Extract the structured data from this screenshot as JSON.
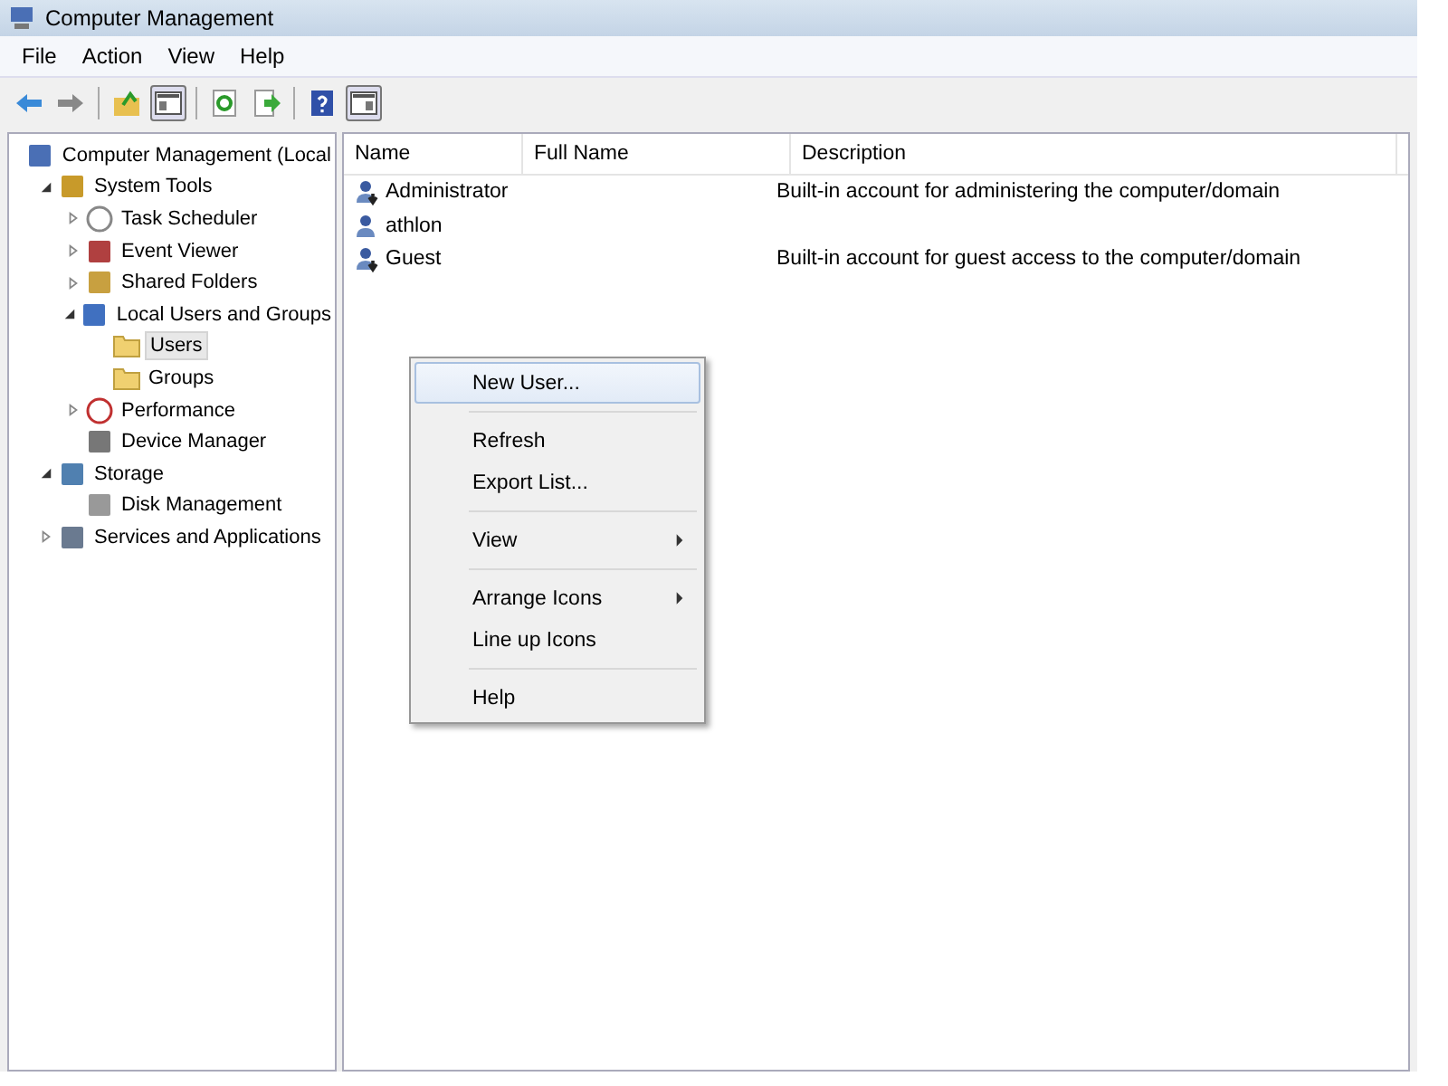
{
  "window": {
    "title": "Computer Management"
  },
  "menu_bar": [
    "File",
    "Action",
    "View",
    "Help"
  ],
  "toolbar": [
    {
      "kind": "back"
    },
    {
      "kind": "forward"
    },
    {
      "kind": "sep"
    },
    {
      "kind": "up"
    },
    {
      "kind": "pane",
      "selected": true
    },
    {
      "kind": "sep"
    },
    {
      "kind": "refresh"
    },
    {
      "kind": "export"
    },
    {
      "kind": "sep"
    },
    {
      "kind": "help"
    },
    {
      "kind": "pane2",
      "selected": true
    }
  ],
  "tree": [
    {
      "label": "Computer Management (Local",
      "kind": "computer",
      "selected": false,
      "children": [
        {
          "label": "System Tools",
          "kind": "tools",
          "selected": false,
          "expanded": true,
          "children": [
            {
              "label": "Task Scheduler",
              "kind": "clock",
              "selected": false,
              "expanded": false
            },
            {
              "label": "Event Viewer",
              "kind": "log",
              "selected": false,
              "expanded": false
            },
            {
              "label": "Shared Folders",
              "kind": "share",
              "selected": false,
              "expanded": false
            },
            {
              "label": "Local Users and Groups",
              "kind": "users",
              "selected": false,
              "expanded": true,
              "children": [
                {
                  "label": "Users",
                  "kind": "folder",
                  "selected": true
                },
                {
                  "label": "Groups",
                  "kind": "folder",
                  "selected": false
                }
              ]
            },
            {
              "label": "Performance",
              "kind": "performance",
              "selected": false,
              "expanded": false
            },
            {
              "label": "Device Manager",
              "kind": "device",
              "selected": false
            }
          ]
        },
        {
          "label": "Storage",
          "kind": "storage",
          "selected": false,
          "expanded": true,
          "children": [
            {
              "label": "Disk Management",
              "kind": "disk",
              "selected": false
            }
          ]
        },
        {
          "label": "Services and Applications",
          "kind": "services",
          "selected": false,
          "expanded": false
        }
      ]
    }
  ],
  "table": {
    "columns": [
      "Name",
      "Full Name",
      "Description"
    ],
    "rows": [
      {
        "name": "Administrator",
        "full_name": "",
        "description": "Built-in account for administering the computer/domain",
        "disabled": true
      },
      {
        "name": "athlon",
        "description": "",
        "disabled": false
      },
      {
        "name": "Guest",
        "description": "Built-in account for guest access to the computer/domain",
        "disabled": true
      }
    ]
  },
  "context_menu": {
    "groups": [
      [
        {
          "label": "New User...",
          "selected": true,
          "submenu": false
        }
      ],
      [
        {
          "label": "Refresh",
          "selected": false,
          "submenu": false
        },
        {
          "label": "Export List...",
          "selected": false,
          "submenu": false
        }
      ],
      [
        {
          "label": "View",
          "selected": false,
          "submenu": true
        }
      ],
      [
        {
          "label": "Arrange Icons",
          "selected": false,
          "submenu": true
        },
        {
          "label": "Line up Icons",
          "selected": false,
          "submenu": false
        }
      ],
      [
        {
          "label": "Help",
          "selected": false,
          "submenu": false
        }
      ]
    ]
  }
}
